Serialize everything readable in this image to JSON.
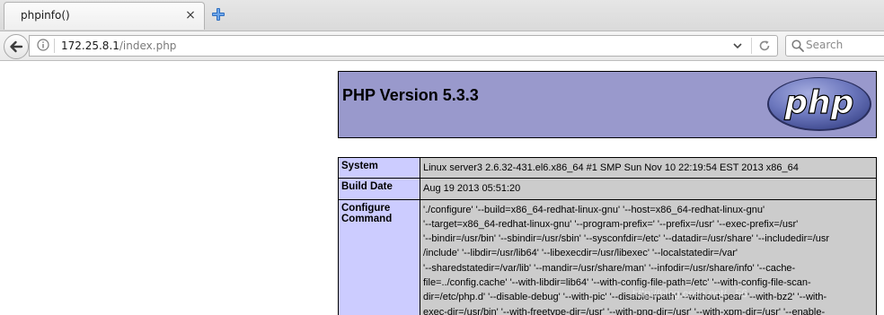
{
  "tab": {
    "title": "phpinfo()",
    "close_label": "×"
  },
  "navbar": {
    "url_host": "172.25.8.1",
    "url_path": "/index.php",
    "search_placeholder": "Search"
  },
  "page": {
    "php_version": "PHP Version 5.3.3",
    "logo_text": "php",
    "rows": [
      {
        "label": "System",
        "value": "Linux server3 2.6.32-431.el6.x86_64 #1 SMP Sun Nov 10 22:19:54 EST 2013 x86_64"
      },
      {
        "label": "Build Date",
        "value": "Aug 19 2013 05:51:20"
      },
      {
        "label_lines": [
          "Configure",
          "Command"
        ],
        "value_lines": [
          "'./configure' '--build=x86_64-redhat-linux-gnu' '--host=x86_64-redhat-linux-gnu'",
          "'--target=x86_64-redhat-linux-gnu' '--program-prefix=' '--prefix=/usr' '--exec-prefix=/usr'",
          "'--bindir=/usr/bin' '--sbindir=/usr/sbin' '--sysconfdir=/etc' '--datadir=/usr/share' '--includedir=/usr",
          "/include' '--libdir=/usr/lib64' '--libexecdir=/usr/libexec' '--localstatedir=/var'",
          "'--sharedstatedir=/var/lib' '--mandir=/usr/share/man' '--infodir=/usr/share/info' '--cache-",
          "file=../config.cache' '--with-libdir=lib64' '--with-config-file-path=/etc' '--with-config-file-scan-",
          "dir=/etc/php.d' '--disable-debug' '--with-pic' '--disable-rpath' '--without-pear' '--with-bz2' '--with-",
          "exec-dir=/usr/bin' '--with-freetype-dir=/usr' '--with-png-dir=/usr' '--with-xpm-dir=/usr' '--enable-"
        ]
      }
    ]
  },
  "watermark": "http://blog.csdn.net/...56"
}
